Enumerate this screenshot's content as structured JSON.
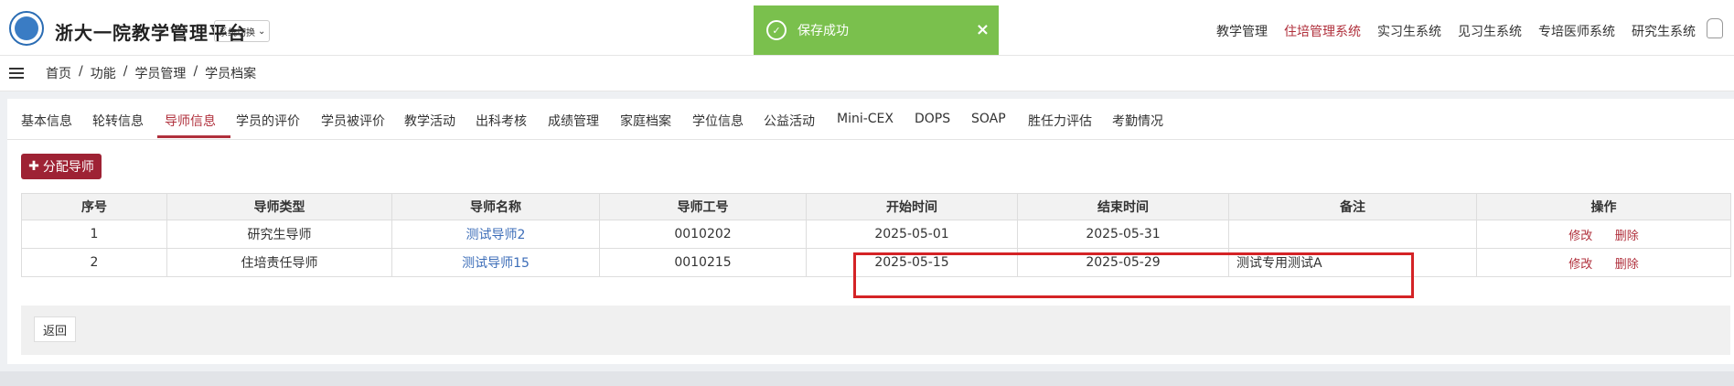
{
  "header": {
    "title": "浙大一院教学管理平台",
    "switch_label": "系统切换",
    "nav": [
      {
        "label": "教学管理",
        "active": false
      },
      {
        "label": "住培管理系统",
        "active": true
      },
      {
        "label": "实习生系统",
        "active": false
      },
      {
        "label": "见习生系统",
        "active": false
      },
      {
        "label": "专培医师系统",
        "active": false
      },
      {
        "label": "研究生系统",
        "active": false
      }
    ]
  },
  "toast": {
    "message": "保存成功",
    "icon": "check-circle-icon",
    "color": "#7ac04d"
  },
  "breadcrumb": [
    "首页",
    "功能",
    "学员管理",
    "学员档案"
  ],
  "tabs": [
    "基本信息",
    "轮转信息",
    "导师信息",
    "学员的评价",
    "学员被评价",
    "教学活动",
    "出科考核",
    "成绩管理",
    "家庭档案",
    "学位信息",
    "公益活动",
    "Mini-CEX",
    "DOPS",
    "SOAP",
    "胜任力评估",
    "考勤情况"
  ],
  "active_tab": "导师信息",
  "assign_button": "分配导师",
  "table": {
    "headers": [
      "序号",
      "导师类型",
      "导师名称",
      "导师工号",
      "开始时间",
      "结束时间",
      "备注",
      "操作"
    ],
    "rows": [
      {
        "no": "1",
        "type": "研究生导师",
        "name": "测试导师2",
        "id": "0010202",
        "start": "2025-05-01",
        "end": "2025-05-31",
        "remark": "",
        "edit": "修改",
        "del": "删除"
      },
      {
        "no": "2",
        "type": "住培责任导师",
        "name": "测试导师15",
        "id": "0010215",
        "start": "2025-05-15",
        "end": "2025-05-29",
        "remark": "测试专用测试A",
        "edit": "修改",
        "del": "删除"
      }
    ]
  },
  "back_button": "返回",
  "colors": {
    "accent": "#b0303c",
    "button": "#9e2234",
    "link": "#3c6db8",
    "highlight": "#d42326"
  }
}
